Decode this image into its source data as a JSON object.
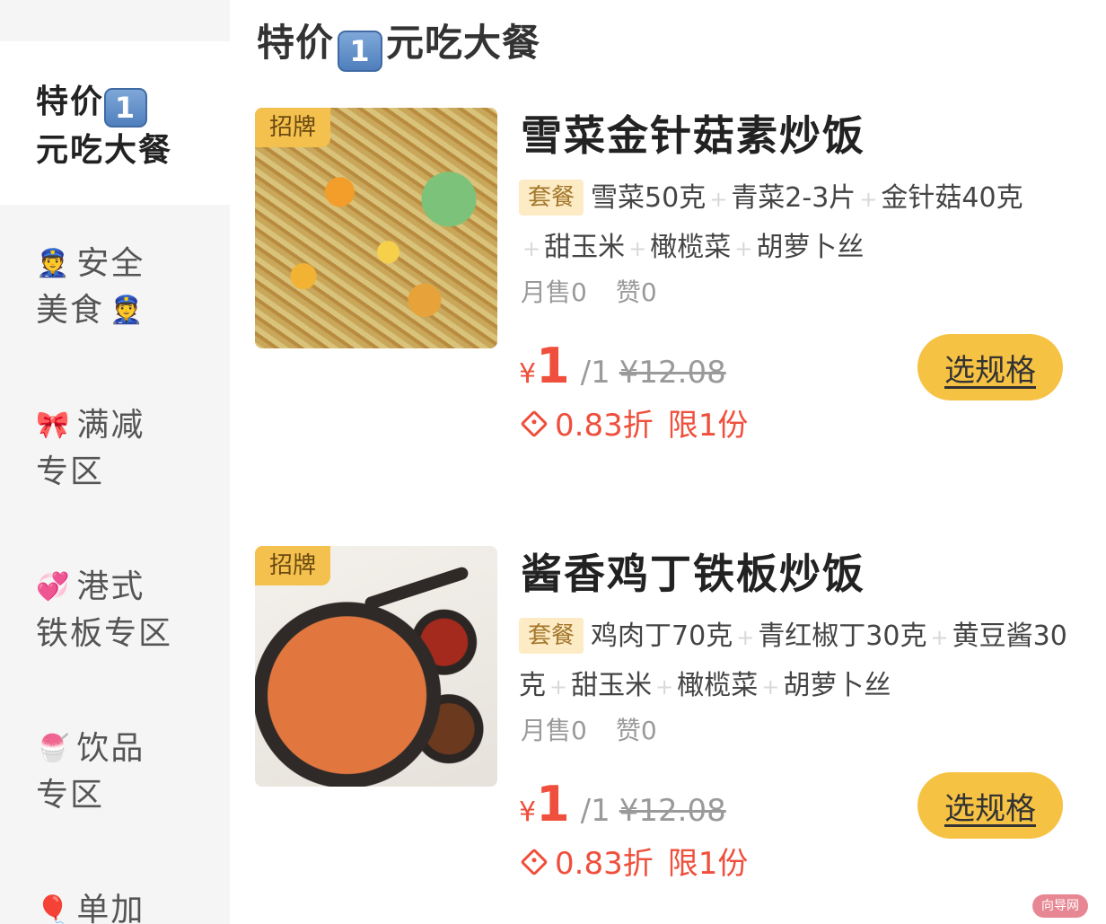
{
  "sidebar": {
    "items": [
      {
        "emoji": "",
        "lines": [
          "特价",
          "元吃大餐"
        ],
        "keycap": "1",
        "active": true
      },
      {
        "emoji": "👮",
        "lines": [
          "安全",
          "美食"
        ],
        "trailing_emoji": "👮",
        "active": false
      },
      {
        "emoji": "🎀",
        "lines": [
          "满减",
          "专区"
        ],
        "active": false
      },
      {
        "emoji": "💞",
        "lines": [
          "港式",
          "铁板专区"
        ],
        "active": false
      },
      {
        "emoji": "🍧",
        "lines": [
          "饮品",
          "专区"
        ],
        "active": false
      },
      {
        "emoji": "🎈",
        "lines": [
          "单加"
        ],
        "active": false
      }
    ]
  },
  "section": {
    "title_before": "特价",
    "title_keycap": "1",
    "title_after": "元吃大餐"
  },
  "products": [
    {
      "badge": "招牌",
      "name": "雪菜金针菇素炒饭",
      "tag": "套餐",
      "ingredients": [
        "雪菜50克",
        "青菜2-3片",
        "金针菇40克",
        "甜玉米",
        "橄榄菜",
        "胡萝卜丝"
      ],
      "monthly_sales": "月售0",
      "likes": "赞0",
      "currency": "¥",
      "price": "1",
      "unit": "/1",
      "original_price": "¥12.08",
      "discount": "0.83折",
      "limit": "限1份",
      "button": "选规格"
    },
    {
      "badge": "招牌",
      "name": "酱香鸡丁铁板炒饭",
      "tag": "套餐",
      "ingredients": [
        "鸡肉丁70克",
        "青红椒丁30克",
        "黄豆酱30克",
        "甜玉米",
        "橄榄菜",
        "胡萝卜丝"
      ],
      "monthly_sales": "月售0",
      "likes": "赞0",
      "currency": "¥",
      "price": "1",
      "unit": "/1",
      "original_price": "¥12.08",
      "discount": "0.83折",
      "limit": "限1份",
      "button": "选规格"
    }
  ],
  "watermark": "向导网",
  "colors": {
    "accent_red": "#ef4f3c",
    "button_yellow": "#f6c243",
    "badge_yellow": "#f4c04e",
    "tag_bg": "#fcebc5",
    "sidebar_bg": "#f5f5f5"
  }
}
